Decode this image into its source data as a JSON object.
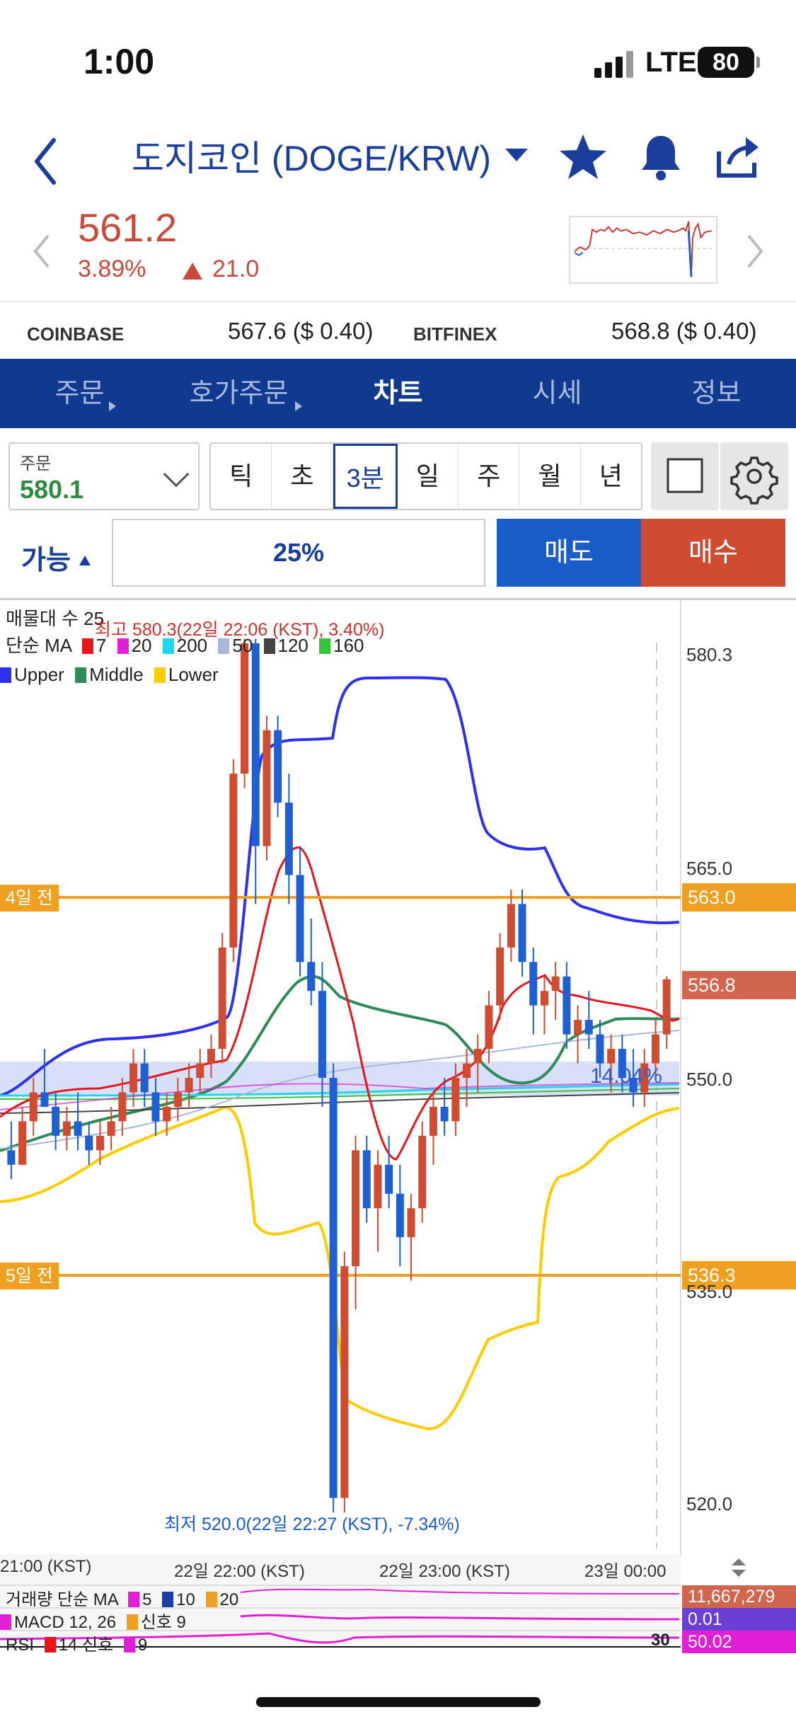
{
  "status": {
    "time": "1:00",
    "network": "LTE",
    "battery": "80"
  },
  "header": {
    "title": "도지코인 (DOGE/KRW)",
    "icons": [
      "back-chevron-icon",
      "dropdown-caret-icon",
      "star-icon",
      "bell-icon",
      "share-icon"
    ]
  },
  "quote": {
    "price": "561.2",
    "change_pct": "3.89%",
    "change_abs": "21.0",
    "up_color": "#c94a3a"
  },
  "exchanges": [
    {
      "name": "COINBASE",
      "value": "567.6 ($ 0.40)"
    },
    {
      "name": "BITFINEX",
      "value": "568.8 ($ 0.40)"
    }
  ],
  "tabs": [
    {
      "label": "주문",
      "active": false
    },
    {
      "label": "호가주문",
      "active": false
    },
    {
      "label": "차트",
      "active": true
    },
    {
      "label": "시세",
      "active": false
    },
    {
      "label": "정보",
      "active": false
    }
  ],
  "order": {
    "label": "주문",
    "value": "580.1"
  },
  "intervals": [
    "틱",
    "초",
    "3분",
    "일",
    "주",
    "월",
    "년"
  ],
  "selected_interval": "3분",
  "trade": {
    "avail_label": "가능",
    "ratio": "25%",
    "sell": "매도",
    "buy": "매수"
  },
  "chart_labels": {
    "volume_profile": "매물대 수 25",
    "ma_title": "단순 MA",
    "ma_items": [
      {
        "label": "7",
        "color": "#e8151b"
      },
      {
        "label": "20",
        "color": "#e11fd6"
      },
      {
        "label": "200",
        "color": "#21d6e8"
      },
      {
        "label": "50",
        "color": "#a9b6de"
      },
      {
        "label": "120",
        "color": "#444444"
      },
      {
        "label": "160",
        "color": "#35c43c"
      }
    ],
    "bb_items": [
      {
        "label": "Upper",
        "color": "#2f2ff0"
      },
      {
        "label": "Middle",
        "color": "#2e8b57"
      },
      {
        "label": "Lower",
        "color": "#ffcc00"
      }
    ],
    "high_note": "최고 580.3(22일 22:06 (KST), 3.40%)",
    "low_note": "최저 520.0(22일 22:27 (KST), -7.34%)",
    "vp_pct": "14.04%",
    "hline_top": {
      "label": "4일 전",
      "value": "563.0"
    },
    "hline_bottom": {
      "label": "5일 전",
      "value": "536.3"
    },
    "current_price": "556.8",
    "y_ticks": [
      "580.3",
      "565.0",
      "550.0",
      "535.0",
      "520.0"
    ],
    "x_ticks": [
      "21:00 (KST)",
      "22일 22:00 (KST)",
      "22일 23:00 (KST)",
      "23일 00:00"
    ],
    "volume_line": "거래량 단순 MA",
    "volume_items": [
      "5",
      "10",
      "20"
    ],
    "volume_value": "11,667,279",
    "macd_line": "MACD 12, 26",
    "macd_signal": "신호 9",
    "macd_value": "0.01",
    "rsi_line": "RSI",
    "rsi_period": "14 신호",
    "rsi_signal": "9",
    "rsi_value": "50.02",
    "rsi_level": "30"
  },
  "chart_data": {
    "type": "candlestick",
    "ylim": [
      518,
      582
    ],
    "candles": [
      [
        545,
        547,
        543,
        544
      ],
      [
        544,
        548,
        544,
        547
      ],
      [
        547,
        550,
        546,
        549
      ],
      [
        549,
        552,
        548,
        548
      ],
      [
        548,
        549,
        545,
        546
      ],
      [
        546,
        548,
        545,
        547
      ],
      [
        547,
        549,
        545,
        546
      ],
      [
        546,
        547,
        544,
        545
      ],
      [
        545,
        547,
        544,
        546
      ],
      [
        546,
        548,
        545,
        547
      ],
      [
        547,
        550,
        546,
        549
      ],
      [
        549,
        552,
        548,
        551
      ],
      [
        551,
        552,
        548,
        549
      ],
      [
        549,
        550,
        546,
        547
      ],
      [
        547,
        549,
        546,
        548
      ],
      [
        548,
        550,
        547,
        549
      ],
      [
        549,
        551,
        548,
        550
      ],
      [
        550,
        552,
        549,
        551
      ],
      [
        551,
        553,
        550,
        552
      ],
      [
        552,
        560,
        551,
        559
      ],
      [
        559,
        572,
        558,
        571
      ],
      [
        571,
        580.3,
        570,
        580
      ],
      [
        580,
        580.3,
        562,
        566
      ],
      [
        566,
        575,
        565,
        574
      ],
      [
        574,
        575,
        568,
        569
      ],
      [
        569,
        571,
        562,
        564
      ],
      [
        564,
        566,
        557,
        558
      ],
      [
        558,
        561,
        555,
        556
      ],
      [
        556,
        558,
        548,
        550
      ],
      [
        550,
        551,
        520,
        521
      ],
      [
        521,
        538,
        520,
        537
      ],
      [
        537,
        546,
        534,
        545
      ],
      [
        545,
        546,
        540,
        541
      ],
      [
        541,
        545,
        538,
        544
      ],
      [
        544,
        546,
        541,
        542
      ],
      [
        542,
        544,
        537,
        539
      ],
      [
        539,
        542,
        536,
        541
      ],
      [
        541,
        547,
        540,
        546
      ],
      [
        546,
        549,
        544,
        548
      ],
      [
        548,
        550,
        546,
        547
      ],
      [
        547,
        551,
        546,
        550
      ],
      [
        550,
        552,
        548,
        551
      ],
      [
        551,
        553,
        549,
        552
      ],
      [
        552,
        556,
        551,
        555
      ],
      [
        555,
        560,
        554,
        559
      ],
      [
        559,
        563,
        558,
        562
      ],
      [
        562,
        563,
        557,
        558
      ],
      [
        558,
        559,
        553,
        555
      ],
      [
        555,
        557,
        553,
        556
      ],
      [
        556,
        558,
        554,
        557
      ],
      [
        557,
        558,
        552,
        553
      ],
      [
        553,
        555,
        551,
        554
      ],
      [
        554,
        556,
        552,
        553
      ],
      [
        553,
        554,
        550,
        551
      ],
      [
        551,
        553,
        549,
        552
      ],
      [
        552,
        553,
        549,
        550
      ],
      [
        550,
        552,
        548,
        549
      ],
      [
        549,
        552,
        548,
        551
      ],
      [
        551,
        554,
        550,
        553
      ],
      [
        553,
        557,
        552,
        556.8
      ]
    ]
  }
}
